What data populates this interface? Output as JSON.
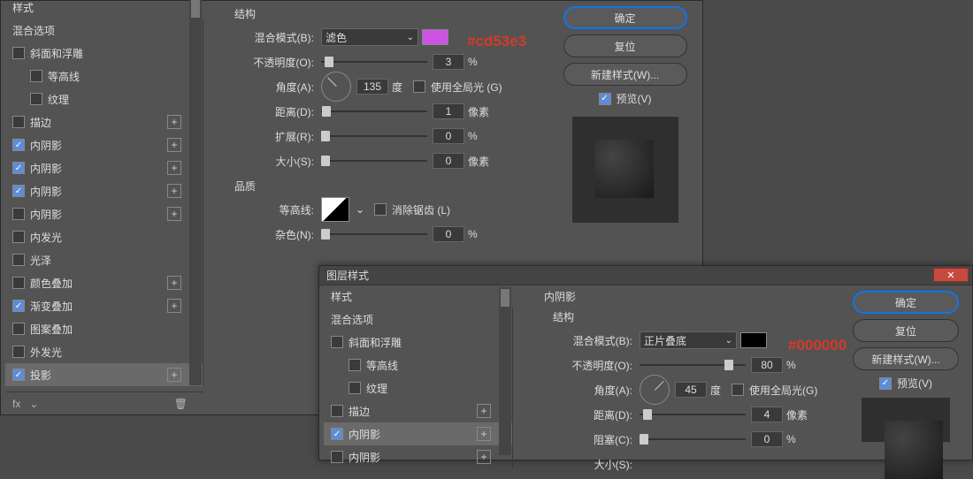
{
  "dialog1": {
    "styles_header": "样式",
    "style_items": [
      {
        "label": "混合选项",
        "cb": null,
        "indent": 0,
        "add": false,
        "sel": false
      },
      {
        "label": "斜面和浮雕",
        "cb": false,
        "indent": 0,
        "add": false
      },
      {
        "label": "等高线",
        "cb": false,
        "indent": 1,
        "add": false
      },
      {
        "label": "纹理",
        "cb": false,
        "indent": 1,
        "add": false
      },
      {
        "label": "描边",
        "cb": false,
        "indent": 0,
        "add": true
      },
      {
        "label": "内阴影",
        "cb": true,
        "indent": 0,
        "add": true
      },
      {
        "label": "内阴影",
        "cb": true,
        "indent": 0,
        "add": true
      },
      {
        "label": "内阴影",
        "cb": true,
        "indent": 0,
        "add": true
      },
      {
        "label": "内阴影",
        "cb": false,
        "indent": 0,
        "add": true
      },
      {
        "label": "内发光",
        "cb": false,
        "indent": 0,
        "add": false
      },
      {
        "label": "光泽",
        "cb": false,
        "indent": 0,
        "add": false
      },
      {
        "label": "颜色叠加",
        "cb": false,
        "indent": 0,
        "add": true
      },
      {
        "label": "渐变叠加",
        "cb": true,
        "indent": 0,
        "add": true
      },
      {
        "label": "图案叠加",
        "cb": false,
        "indent": 0,
        "add": false
      },
      {
        "label": "外发光",
        "cb": false,
        "indent": 0,
        "add": false
      },
      {
        "label": "投影",
        "cb": true,
        "indent": 0,
        "add": true,
        "sel": true
      }
    ],
    "fxbar": {
      "fx": "fx",
      "chev": "⌄",
      "trash": "🗑"
    },
    "structure": {
      "title": "结构",
      "blend_mode_label": "混合模式(B):",
      "blend_mode_value": "滤色",
      "color": "#cd53e3",
      "opacity_label": "不透明度(O):",
      "opacity_value": "3",
      "opacity_unit": "%",
      "angle_label": "角度(A):",
      "angle_value": "135",
      "angle_unit": "度",
      "global_light_label": "使用全局光 (G)",
      "global_light_on": false,
      "distance_label": "距离(D):",
      "distance_value": "1",
      "distance_unit": "像素",
      "spread_label": "扩展(R):",
      "spread_value": "0",
      "spread_unit": "%",
      "size_label": "大小(S):",
      "size_value": "0",
      "size_unit": "像素"
    },
    "quality": {
      "title": "品质",
      "contour_label": "等高线:",
      "antialias_label": "消除锯齿 (L)",
      "antialias_on": false,
      "noise_label": "杂色(N):",
      "noise_value": "0",
      "noise_unit": "%"
    },
    "buttons": {
      "ok": "确定",
      "cancel": "复位",
      "new_style": "新建样式(W)...",
      "preview": "预览(V)",
      "preview_on": true
    },
    "annotation": "#cd53e3"
  },
  "dialog2": {
    "title": "图层样式",
    "styles_header": "样式",
    "style_items": [
      {
        "label": "混合选项",
        "cb": null,
        "indent": 0
      },
      {
        "label": "斜面和浮雕",
        "cb": false,
        "indent": 0
      },
      {
        "label": "等高线",
        "cb": false,
        "indent": 1
      },
      {
        "label": "纹理",
        "cb": false,
        "indent": 1
      },
      {
        "label": "描边",
        "cb": false,
        "indent": 0,
        "add": true
      },
      {
        "label": "内阴影",
        "cb": true,
        "indent": 0,
        "add": true,
        "sel": true
      },
      {
        "label": "内阴影",
        "cb": false,
        "indent": 0,
        "add": true
      }
    ],
    "effect_title": "内阴影",
    "structure": {
      "title": "结构",
      "blend_mode_label": "混合模式(B):",
      "blend_mode_value": "正片叠底",
      "color": "#000000",
      "opacity_label": "不透明度(O):",
      "opacity_value": "80",
      "opacity_unit": "%",
      "angle_label": "角度(A):",
      "angle_value": "45",
      "angle_unit": "度",
      "global_light_label": "使用全局光(G)",
      "global_light_on": false,
      "distance_label": "距离(D):",
      "distance_value": "4",
      "distance_unit": "像素",
      "choke_label": "阻塞(C):",
      "choke_value": "0",
      "choke_unit": "%",
      "size_label": "大小(S):"
    },
    "buttons": {
      "ok": "确定",
      "cancel": "复位",
      "new_style": "新建样式(W)...",
      "preview": "预览(V)",
      "preview_on": true
    },
    "annotation": "#000000"
  }
}
